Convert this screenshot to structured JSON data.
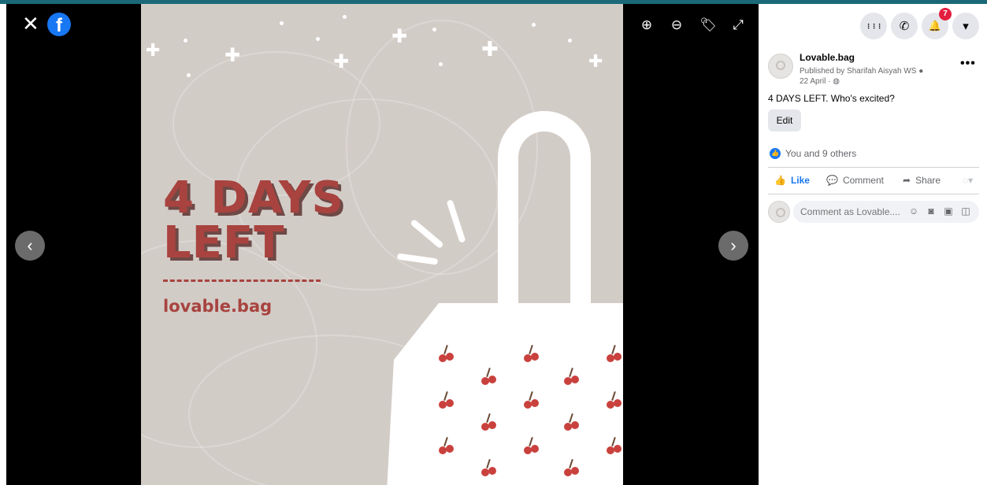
{
  "viewer": {
    "close_glyph": "✕",
    "logo_glyph": "f",
    "tools": {
      "zoom_in": "⊕",
      "zoom_out": "⊖",
      "tag": "🏷",
      "fullscreen": "⤢"
    },
    "prev_glyph": "‹",
    "next_glyph": "›"
  },
  "photo": {
    "headline_line1": "4 DAYS",
    "headline_line2": "LEFT",
    "brand": "lovable.bag",
    "accent_color": "#a8433f",
    "background_color": "#d2ccc7"
  },
  "topbar": {
    "notification_count": "7",
    "menu_glyph": "⋮⋮⋮",
    "messenger_glyph": "✆",
    "bell_glyph": "🔔",
    "dropdown_glyph": "▾"
  },
  "post": {
    "page_name": "Lovable.bag",
    "published_by": "Published by Sharifah Aisyah WS",
    "date": "22 April ·",
    "more_glyph": "•••",
    "text": "4 DAYS LEFT. Who's excited?",
    "edit_label": "Edit",
    "reactions_text": "You and 9 others",
    "actions": {
      "like": "Like",
      "comment": "Comment",
      "share": "Share"
    },
    "comment_placeholder": "Comment as Lovable....",
    "like_color": "#1877f2"
  }
}
